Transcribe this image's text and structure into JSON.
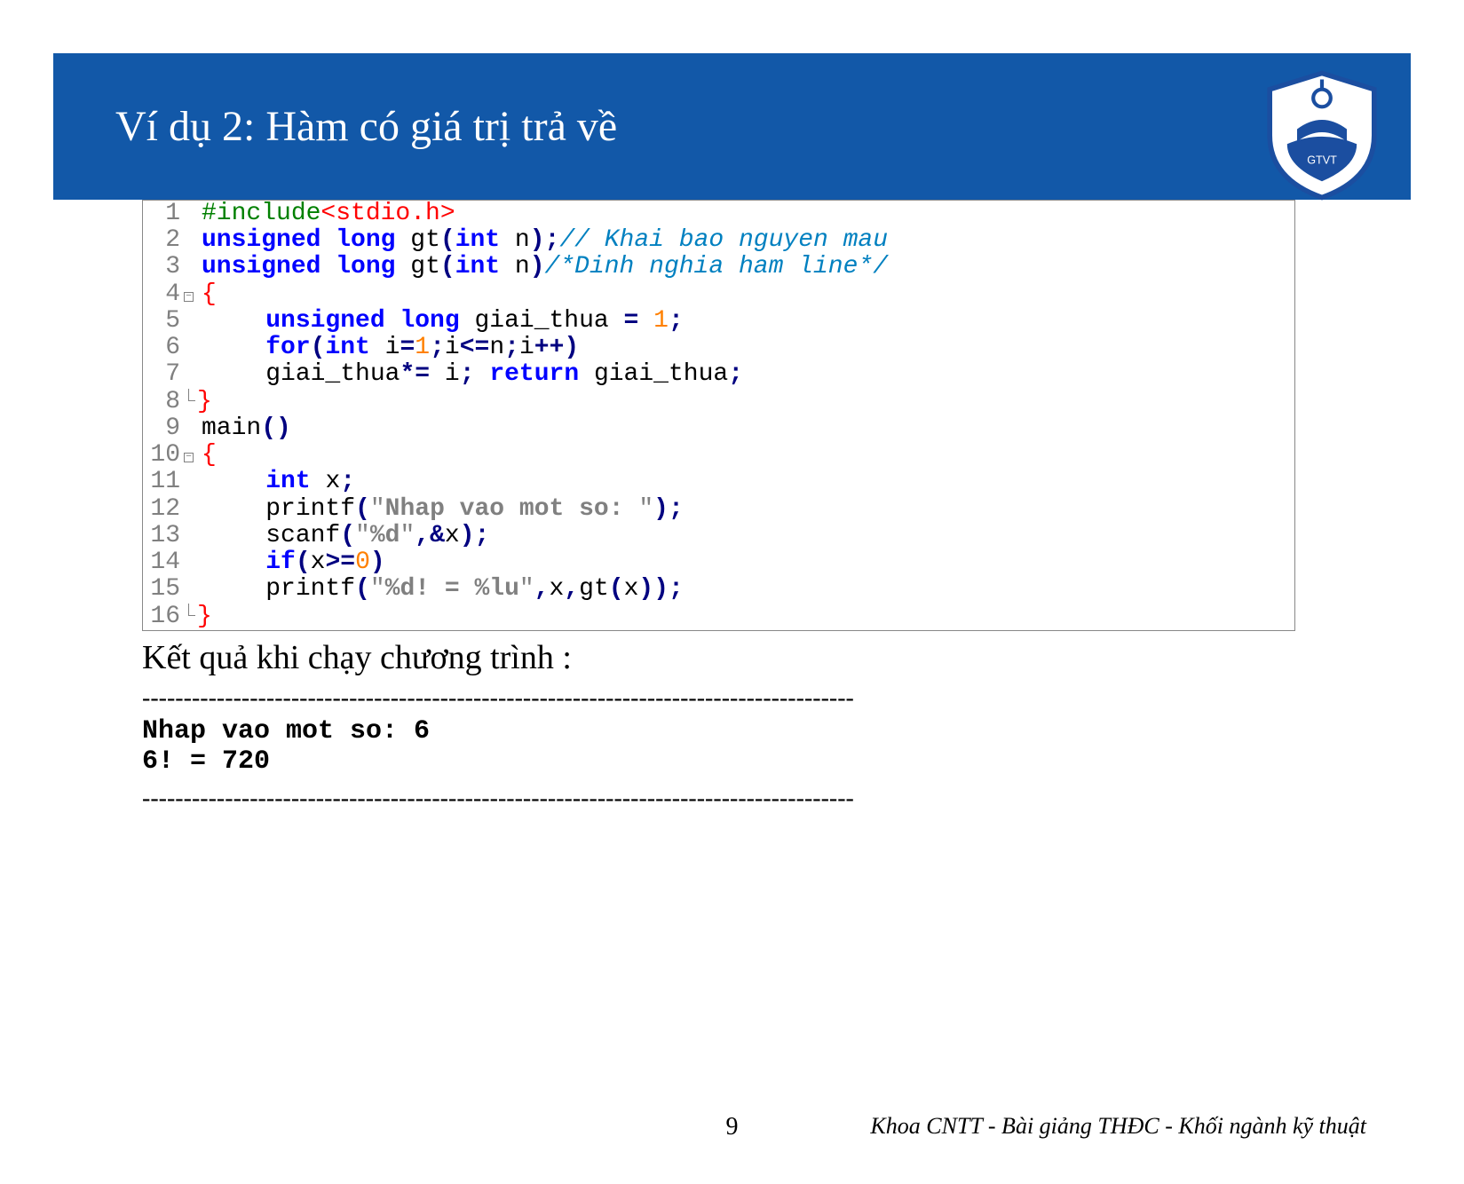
{
  "header": {
    "title": "Ví dụ 2: Hàm có giá trị trả về"
  },
  "code": {
    "line1": {
      "n": "1",
      "include": "#include",
      "hdr": "<stdio.h>"
    },
    "line2": {
      "n": "2",
      "kw1": "unsigned",
      "kw2": "long",
      "fn": "gt",
      "p1": "(",
      "kw3": "int",
      "arg": " n",
      "p2": ")",
      "semi": ";",
      "cmt": "// Khai bao nguyen mau"
    },
    "line3": {
      "n": "3",
      "kw1": "unsigned",
      "kw2": "long",
      "fn": "gt",
      "p1": "(",
      "kw3": "int",
      "arg": " n",
      "p2": ")",
      "cmt": "/*Dinh nghia ham line*/"
    },
    "line4": {
      "n": "4",
      "br": "{"
    },
    "line5": {
      "n": "5",
      "kw1": "unsigned",
      "kw2": "long",
      "var": "giai_thua ",
      "op": "=",
      "sp": " ",
      "num": "1",
      "semi": ";"
    },
    "line6": {
      "n": "6",
      "kw1": "for",
      "p1": "(",
      "kw2": "int",
      "txt1": " i",
      "op1": "=",
      "num1": "1",
      "semi1": ";",
      "txt2": "i",
      "op2": "<=",
      "txt3": "n",
      "semi2": ";",
      "txt4": "i",
      "op3": "++",
      "p2": ")"
    },
    "line7": {
      "n": "7",
      "var": "giai_thua",
      "op1": "*=",
      "sp1": " ",
      "txt1": "i",
      "semi1": ";",
      "sp2": " ",
      "kw": "return",
      "sp3": " ",
      "txt2": "giai_thua",
      "semi2": ";"
    },
    "line8": {
      "n": "8",
      "br": "}"
    },
    "line9": {
      "n": "9",
      "fn": "main",
      "p1": "(",
      "p2": ")"
    },
    "line10": {
      "n": "10",
      "br": "{"
    },
    "line11": {
      "n": "11",
      "kw": "int",
      "var": " x",
      "semi": ";"
    },
    "line12": {
      "n": "12",
      "fn": "printf",
      "p1": "(",
      "q1": "\"",
      "str": "Nhap vao mot so: ",
      "q2": "\"",
      "p2": ")",
      "semi": ";"
    },
    "line13": {
      "n": "13",
      "fn": "scanf",
      "p1": "(",
      "q1": "\"",
      "str": "%d",
      "q2": "\"",
      "comma": ",",
      "amp": "&",
      "var": "x",
      "p2": ")",
      "semi": ";"
    },
    "line14": {
      "n": "14",
      "kw": "if",
      "p1": "(",
      "var": "x",
      "op": ">=",
      "num": "0",
      "p2": ")"
    },
    "line15": {
      "n": "15",
      "fn": "printf",
      "p1": "(",
      "q1": "\"",
      "str": "%d! = %lu",
      "q2": "\"",
      "comma1": ",",
      "var": "x",
      "comma2": ",",
      "fn2": "gt",
      "p3": "(",
      "var2": "x",
      "p4": ")",
      "p5": ")",
      "semi": ";"
    },
    "line16": {
      "n": "16",
      "br": "}"
    }
  },
  "result": {
    "label": "Kết quả khi chạy chương trình :",
    "dashes": "--------------------------------------------------------------------------------------",
    "out1": "Nhap vao mot so: 6",
    "out2": "6! = 720"
  },
  "footer": {
    "page": "9",
    "right": "Khoa CNTT - Bài giảng THĐC - Khối ngành kỹ thuật"
  }
}
